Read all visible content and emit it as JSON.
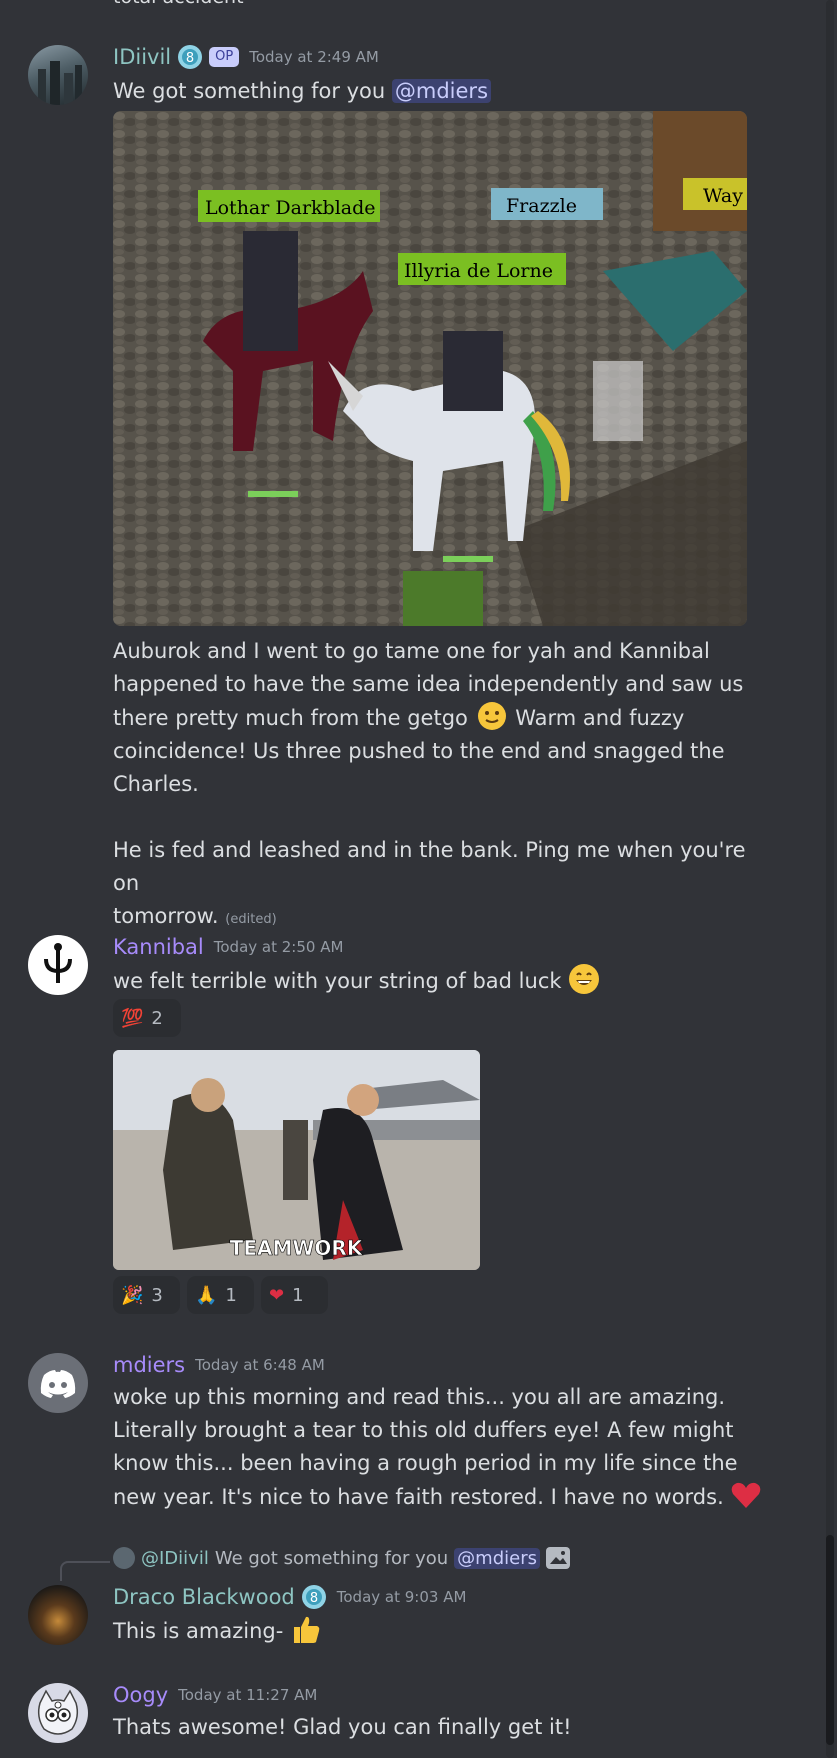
{
  "top_cut_text": "total accident",
  "colors": {
    "username_idiivil": "#8ec5c2",
    "username_purple": "#a78bfa",
    "username_draco": "#8ec5c2",
    "username_oogy": "#a78bfa",
    "mention_bg": "#3c4270",
    "mention_fg": "#c9cdfb"
  },
  "messages": [
    {
      "author": "IDiivil",
      "op_badge": "OP",
      "timestamp": "Today at 2:49 AM",
      "line1_prefix": "We got something for you ",
      "mention": "@mdiers",
      "game_labels": [
        "Lothar Darkblade",
        "Frazzle",
        "Illyria de Lorne",
        "Way"
      ],
      "body": [
        "Auburok and I went to go tame one for yah and Kannibal",
        "happened to have the same idea independently and saw us",
        "there pretty much from the getgo",
        "Warm and fuzzy",
        "coincidence! Us three pushed to the end and snagged the",
        "Charles."
      ],
      "body2": [
        "He is fed and leashed and in the bank. Ping me when you're on",
        "tomorrow."
      ],
      "edited": "(edited)",
      "emoji": "slightly-smiling-face-emoji"
    },
    {
      "author": "Kannibal",
      "timestamp": "Today at 2:50 AM",
      "text": "we felt terrible with your string of bad luck",
      "emoji": "grinning-face-emoji",
      "reaction": {
        "emoji": "💯",
        "count": "2"
      },
      "gif_caption": "TEAMWORK",
      "reactions": [
        {
          "emoji": "🎉",
          "count": "3"
        },
        {
          "emoji": "🙏",
          "count": "1"
        },
        {
          "emoji": "❤",
          "count": "1"
        }
      ]
    },
    {
      "author": "mdiers",
      "timestamp": "Today at 6:48 AM",
      "lines": [
        "woke up this morning and read this... you all are amazing.",
        "Literally brought a tear to this old duffers eye! A few might",
        "know this... been having a rough period in my life since the",
        "new year. It's nice to have faith restored. I have no words."
      ],
      "emoji": "red-heart-emoji"
    },
    {
      "reply_author": "@IDiivil",
      "reply_text": "We got something for you",
      "reply_mention": "@mdiers",
      "author": "Draco Blackwood",
      "timestamp": "Today at 9:03 AM",
      "text": "This is amazing-",
      "emoji": "thumbs-up-emoji"
    },
    {
      "author": "Oogy",
      "timestamp": "Today at 11:27 AM",
      "text": "Thats awesome! Glad you can finally get it!"
    }
  ]
}
